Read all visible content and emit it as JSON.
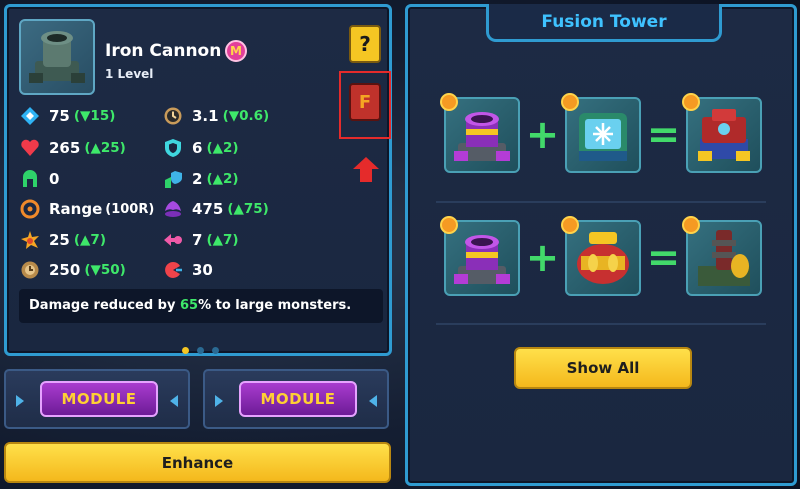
{
  "tower": {
    "name": "Iron Cannon",
    "level": "1 Level",
    "badge": "M"
  },
  "side_buttons": {
    "help_symbol": "?",
    "fusion_book_symbol": "F"
  },
  "stats": {
    "attack": {
      "value": "75",
      "delta": "(▼15)",
      "icon": "attack-diamond-icon"
    },
    "attack_speed": {
      "value": "3.1",
      "delta": "(▼0.6)",
      "icon": "clock-icon"
    },
    "hp": {
      "value": "265",
      "delta": "(▲25)",
      "icon": "heart-icon"
    },
    "defense": {
      "value": "6",
      "delta": "(▲2)",
      "icon": "shield-icon"
    },
    "armor_pierce": {
      "value": "0",
      "delta": "",
      "icon": "armor-icon"
    },
    "magic_defense": {
      "value": "2",
      "delta": "(▲2)",
      "icon": "magic-shield-icon"
    },
    "range": {
      "label": "Range",
      "unit": "(100R)",
      "icon": "crosshair-icon"
    },
    "splash": {
      "value": "475",
      "delta": "(▲75)",
      "icon": "splash-icon"
    },
    "crit": {
      "value": "25",
      "delta": "(▲7)",
      "icon": "explosion-icon"
    },
    "knockback": {
      "value": "7",
      "delta": "(▲7)",
      "icon": "knockback-icon"
    },
    "cooldown": {
      "value": "250",
      "delta": "(▼50)",
      "icon": "cooldown-icon"
    },
    "pacman": {
      "value": "30",
      "delta": "",
      "icon": "chomp-icon"
    }
  },
  "description": {
    "prefix": "Damage reduced by ",
    "highlight": "65",
    "suffix": "% to large monsters."
  },
  "modules": [
    "MODULE",
    "MODULE"
  ],
  "enhance_label": "Enhance",
  "fusion": {
    "title": "Fusion Tower",
    "plus": "+",
    "equals": "=",
    "show_all_label": "Show All"
  },
  "colors": {
    "accent_blue": "#2f9bd1",
    "stat_green": "#3ee86a",
    "button_yellow": "#f4b81c",
    "module_purple": "#8a2fb8",
    "highlight_red": "#e52b2b"
  }
}
